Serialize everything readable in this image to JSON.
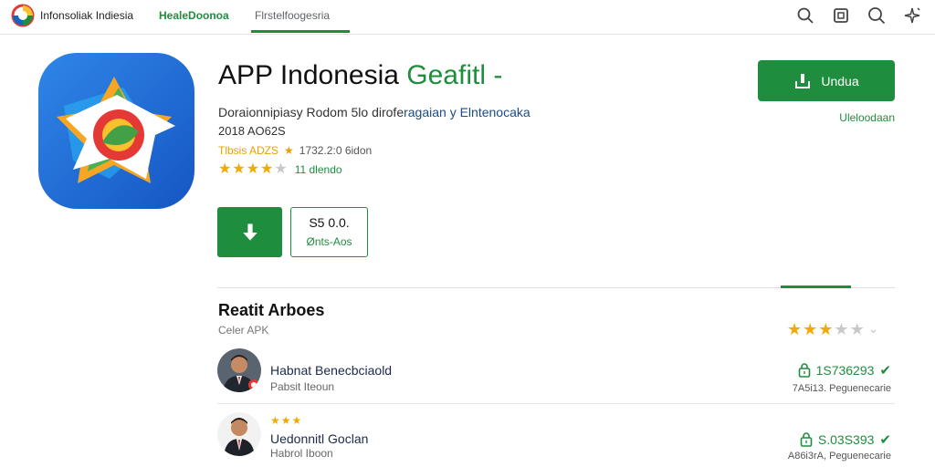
{
  "topbar": {
    "brand_name": "Infonsoliak Indiesia",
    "tabs": [
      {
        "label": "HealeDoonoa"
      },
      {
        "label": "Flrstelfoogesria"
      }
    ],
    "icons": [
      "search-icon",
      "window-icon",
      "search-icon",
      "sparkle-icon"
    ]
  },
  "app": {
    "title_main": "APP Indonesia",
    "title_accent": "Geafitl -",
    "description": "Doraionnipiasy Rodom 5lo dirofe",
    "description_link": "ragaian y Elntenocaka",
    "year": "2018 AO62S",
    "meta_left": "Tlbsis ADZS",
    "meta_mid": "1732.2:0 6idon",
    "rating_value": 3.5,
    "rating_text": "11 dlendo",
    "price_amount": "S5 0.0.",
    "price_label": "Ønts-Aos",
    "install_label": "Undua",
    "install_sub": "Uleloodaan"
  },
  "reviews": {
    "title": "Reatit Arboes",
    "subtitle": "Celer APK",
    "overall_rating": 3,
    "items": [
      {
        "name": "Habnat Benecbciaold",
        "sub": "Pabsit Iteoun",
        "count": "1S736293",
        "right_sub": "7A5i13. Peguenecarie",
        "stars": null
      },
      {
        "name": "Uedonnitl Goclan",
        "sub": "Habrol Iboon",
        "count": "S.03S393",
        "right_sub": "A86i3rA, Peguenecarie",
        "stars": 3
      }
    ]
  },
  "colors": {
    "accent": "#1e8e3e",
    "star": "#f2a900",
    "link": "#1a4a8a"
  }
}
